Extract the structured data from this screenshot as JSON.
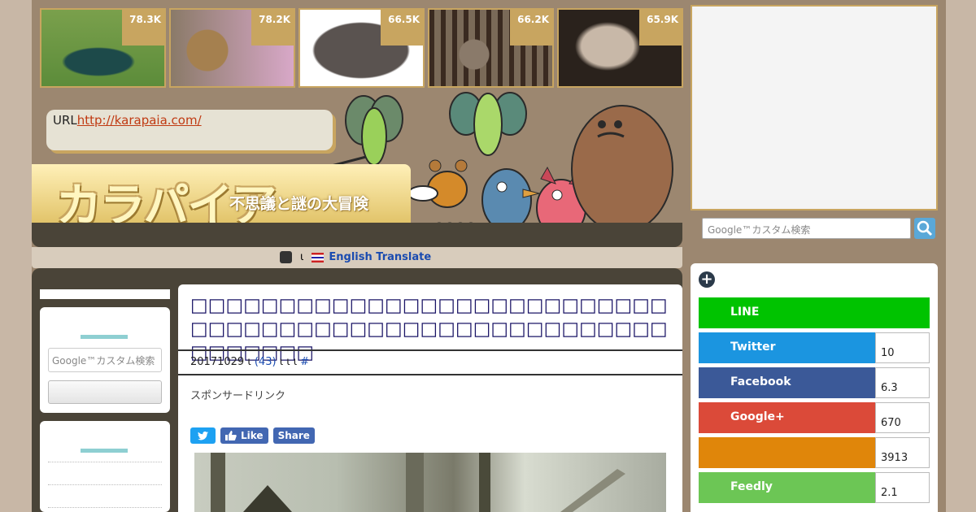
{
  "ranking": [
    {
      "count": "78.3K",
      "color": "#4f7f37"
    },
    {
      "count": "78.2K",
      "color": "#9a7a5a"
    },
    {
      "count": "66.5K",
      "color": "#5a5350"
    },
    {
      "count": "66.2K",
      "color": "#6b5a4a"
    },
    {
      "count": "65.9K",
      "color": "#3a302a"
    }
  ],
  "header": {
    "url_label": "URL",
    "url_link": "http://karapaia.com/",
    "logo": "カラパイア",
    "tagline": "不思議と謎の大冒険"
  },
  "translate": {
    "sep": "ι",
    "link": "English Translate"
  },
  "sidebar_left": {
    "search_placeholder": "Google™カスタム検索"
  },
  "article": {
    "title": "□□□□□□□□□□□□□□□□□□□□□□□□□□□□□□□□□□□□□□□□□□□□□□□□□□□□□□□□□□□□□",
    "date": "20171029",
    "comments": "(43)",
    "meta_tail": "ι ι    ι",
    "hash": "#",
    "sponsor": "スポンサードリンク",
    "share_fb_like": "Like",
    "share_fb_share": "Share"
  },
  "sidebar_right": {
    "search_placeholder": "Google™カスタム検索",
    "share": [
      {
        "label": "LINE",
        "count": "",
        "color": "#00c300"
      },
      {
        "label": "Twitter",
        "count": "10",
        "color": "#1b95e0"
      },
      {
        "label": "Facebook",
        "count": "6.3",
        "color": "#3b5998"
      },
      {
        "label": "Google+",
        "count": "670",
        "color": "#db4a39"
      },
      {
        "label": "",
        "count": "3913",
        "color": "#e0860a"
      },
      {
        "label": "Feedly",
        "count": "2.1",
        "color": "#6cc655"
      }
    ]
  }
}
